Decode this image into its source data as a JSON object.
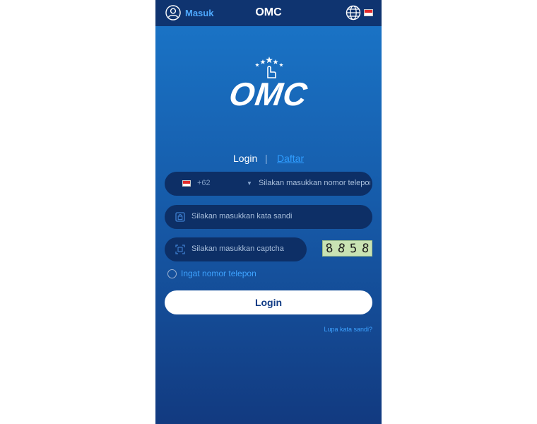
{
  "header": {
    "user_label": "Masuk",
    "title": "OMC",
    "flag": "indonesia-flag"
  },
  "logo": {
    "text": "OMC"
  },
  "auth_tabs": {
    "login": "Login",
    "separator": "|",
    "register": "Daftar"
  },
  "form": {
    "country_code": "+62",
    "phone_placeholder": "Silakan masukkan nomor telepon",
    "password_placeholder": "Silakan masukkan kata sandi",
    "captcha_placeholder": "Silakan masukkan captcha",
    "captcha_digits": [
      "8",
      "8",
      "5",
      "8"
    ],
    "remember_label": "Ingat nomor telepon",
    "submit_label": "Login",
    "forgot_label": "Lupa kata sandi?"
  },
  "colors": {
    "accent": "#2f9dff",
    "header_bg": "#0f3470",
    "field_bg": "#0d2f66",
    "button_text": "#0f3a84"
  }
}
